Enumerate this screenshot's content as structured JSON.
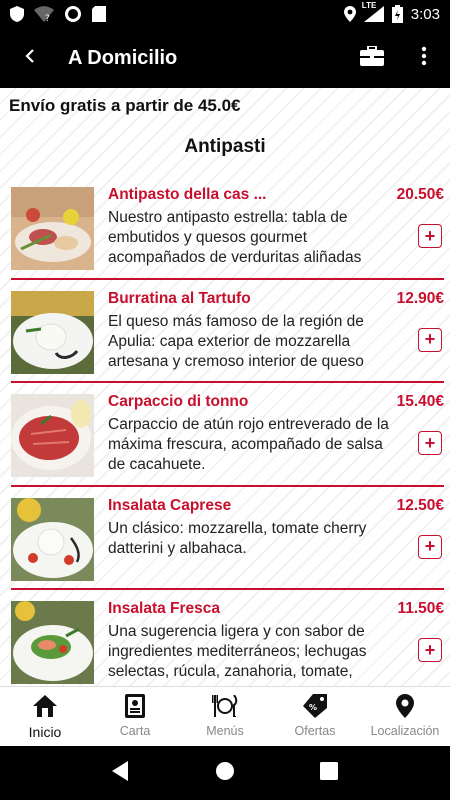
{
  "status": {
    "time": "3:03",
    "network": "LTE"
  },
  "appbar": {
    "title": "A Domicilio"
  },
  "promo": "Envío gratis a partir de 45.0€",
  "section": "Antipasti",
  "items": [
    {
      "name": "Antipasto della cas ...",
      "price": "20.50€",
      "description": "Nuestro antipasto estrella: tabla de embutidos y quesos gourmet acompañados de verduritas aliñadas",
      "add": "+"
    },
    {
      "name": "Burratina al Tartufo",
      "price": "12.90€",
      "description": "El queso más famoso de la región de Apulia: capa exterior de mozzarella artesana y cremoso interior de queso",
      "add": "+"
    },
    {
      "name": "Carpaccio di tonno",
      "price": "15.40€",
      "description": "Carpaccio de atún rojo entreverado de la máxima frescura, acompañado de salsa de cacahuete.",
      "add": "+"
    },
    {
      "name": "Insalata Caprese",
      "price": "12.50€",
      "description": "Un clásico: mozzarella, tomate cherry datterini y albahaca.",
      "add": "+"
    },
    {
      "name": "Insalata Fresca",
      "price": "11.50€",
      "description": "Una sugerencia ligera y con sabor de ingredientes mediterráneos; lechugas selectas, rúcula, zanahoria, tomate,",
      "add": "+"
    }
  ],
  "tabs": [
    {
      "label": "Inicio",
      "icon": "home-icon"
    },
    {
      "label": "Carta",
      "icon": "menu-card-icon"
    },
    {
      "label": "Menús",
      "icon": "cutlery-icon"
    },
    {
      "label": "Ofertas",
      "icon": "offers-tag-icon"
    },
    {
      "label": "Localización",
      "icon": "location-pin-icon"
    }
  ],
  "colors": {
    "accent": "#c8102e",
    "bar": "#000000"
  }
}
